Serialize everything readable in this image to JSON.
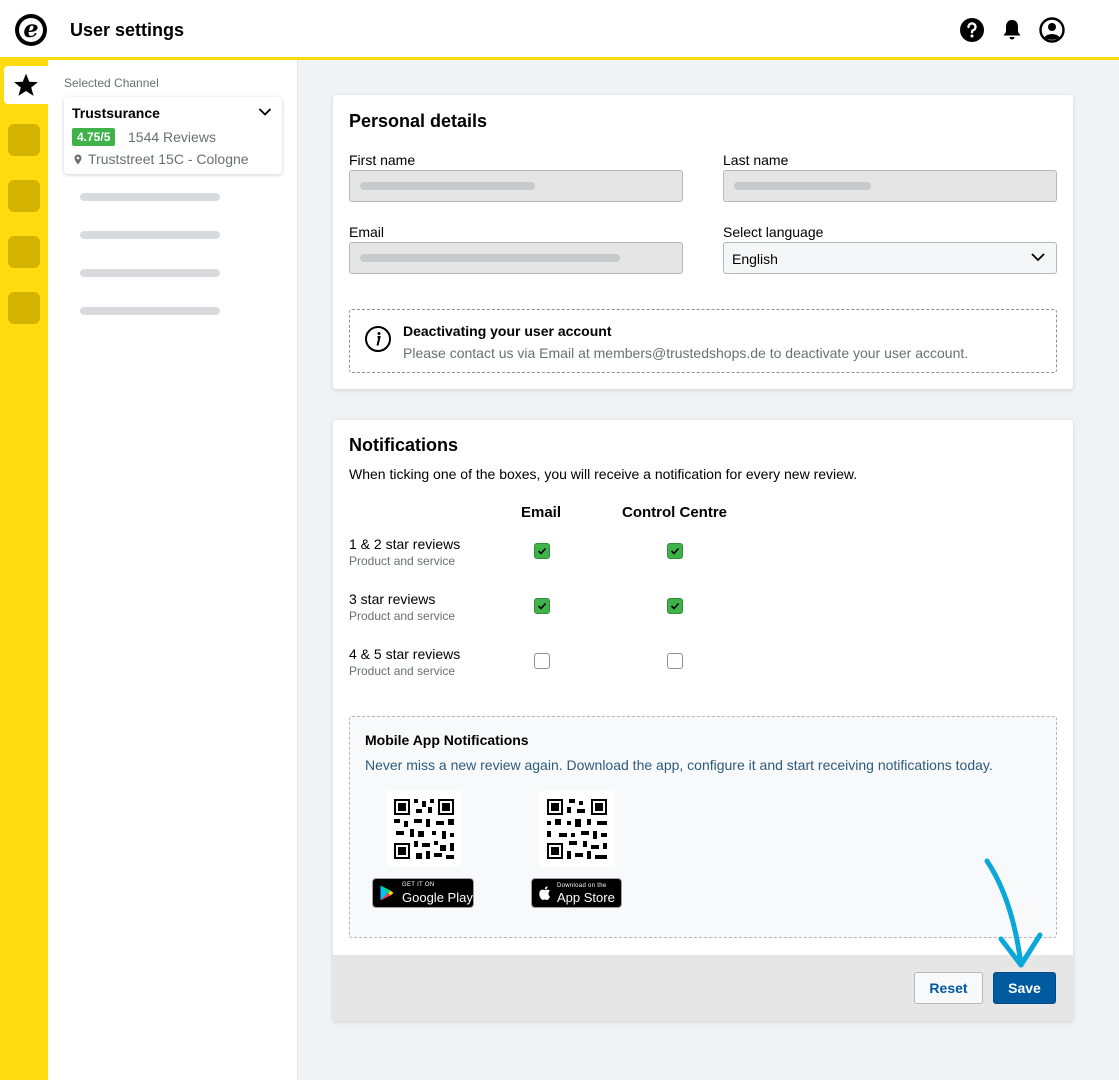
{
  "header": {
    "title": "User settings",
    "logo": "e",
    "icons": [
      "help-icon",
      "bell-icon",
      "account-icon"
    ]
  },
  "colors": {
    "brand_yellow": "#ffdc0f",
    "rating_green": "#3fb249",
    "primary_blue": "#005aa0",
    "annotation_cyan": "#0aa8d8"
  },
  "sidebar": {
    "selected_label": "Selected Channel",
    "channel": {
      "name": "Trustsurance",
      "rating": "4.75/5",
      "reviews": "1544 Reviews",
      "address": "Truststreet 15C - Cologne"
    }
  },
  "personal": {
    "title": "Personal details",
    "first_name_label": "First name",
    "last_name_label": "Last name",
    "email_label": "Email",
    "language_label": "Select language",
    "language_value": "English",
    "info_title": "Deactivating your user account",
    "info_text": "Please contact us via Email at members@trustedshops.de to deactivate your user account."
  },
  "notifications": {
    "title": "Notifications",
    "intro": "When ticking one of the boxes, you will receive a notification for every new review.",
    "columns": [
      "Email",
      "Control Centre"
    ],
    "rows": [
      {
        "title": "1 & 2 star reviews",
        "sub": "Product and service",
        "email": true,
        "control_centre": true
      },
      {
        "title": "3 star reviews",
        "sub": "Product and service",
        "email": true,
        "control_centre": true
      },
      {
        "title": "4 & 5 star reviews",
        "sub": "Product and service",
        "email": false,
        "control_centre": false
      }
    ],
    "app": {
      "title": "Mobile App Notifications",
      "text": "Never miss a new review again. Download the app, configure it and start receiving notifications today.",
      "google_small": "GET IT ON",
      "google_big": "Google Play",
      "apple_small": "Download on the",
      "apple_big": "App Store"
    }
  },
  "actions": {
    "reset": "Reset",
    "save": "Save"
  }
}
